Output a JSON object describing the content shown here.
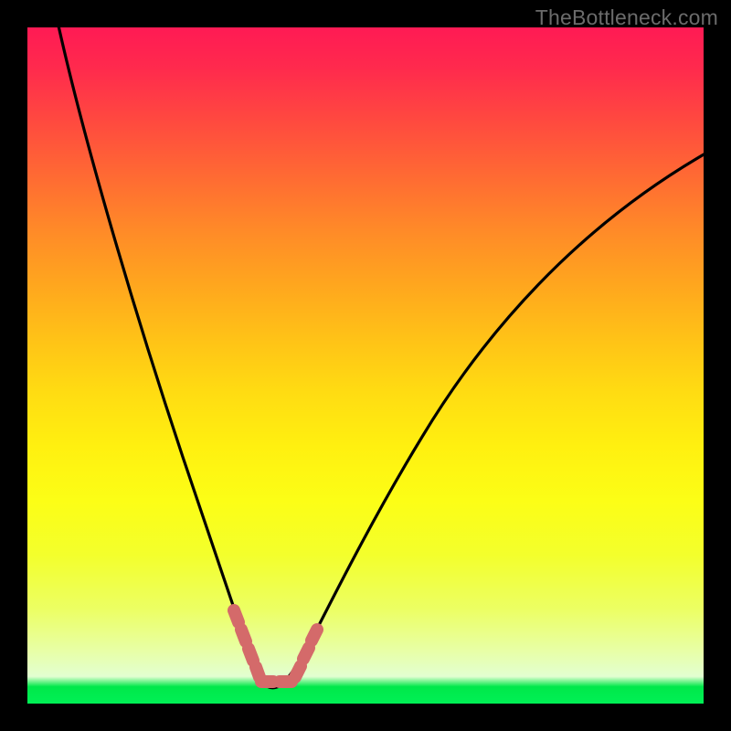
{
  "watermark": "TheBottleneck.com",
  "chart_data": {
    "type": "line",
    "title": "",
    "xlabel": "",
    "ylabel": "",
    "xlim": [
      0,
      100
    ],
    "ylim": [
      0,
      100
    ],
    "series": [
      {
        "name": "bottleneck-curve",
        "x": [
          5,
          10,
          15,
          20,
          25,
          28,
          30,
          32,
          34,
          36,
          38,
          40,
          45,
          50,
          55,
          60,
          70,
          80,
          90,
          100
        ],
        "values": [
          100,
          80,
          62,
          45,
          29,
          18,
          12,
          7,
          3,
          2,
          3,
          6,
          15,
          26,
          36,
          45,
          58,
          68,
          76,
          82
        ]
      },
      {
        "name": "optimal-range-marker",
        "x": [
          29,
          30,
          31,
          32,
          33,
          34,
          35,
          36,
          37,
          38,
          39
        ],
        "values": [
          14,
          10,
          7,
          5,
          3,
          2.5,
          2.5,
          3,
          4,
          6,
          8
        ]
      }
    ],
    "gradient_stops": [
      {
        "pos": 0,
        "color": "#ff1a54"
      },
      {
        "pos": 50,
        "color": "#ffd400"
      },
      {
        "pos": 96,
        "color": "#e8ffc0"
      },
      {
        "pos": 100,
        "color": "#00f055"
      }
    ]
  }
}
